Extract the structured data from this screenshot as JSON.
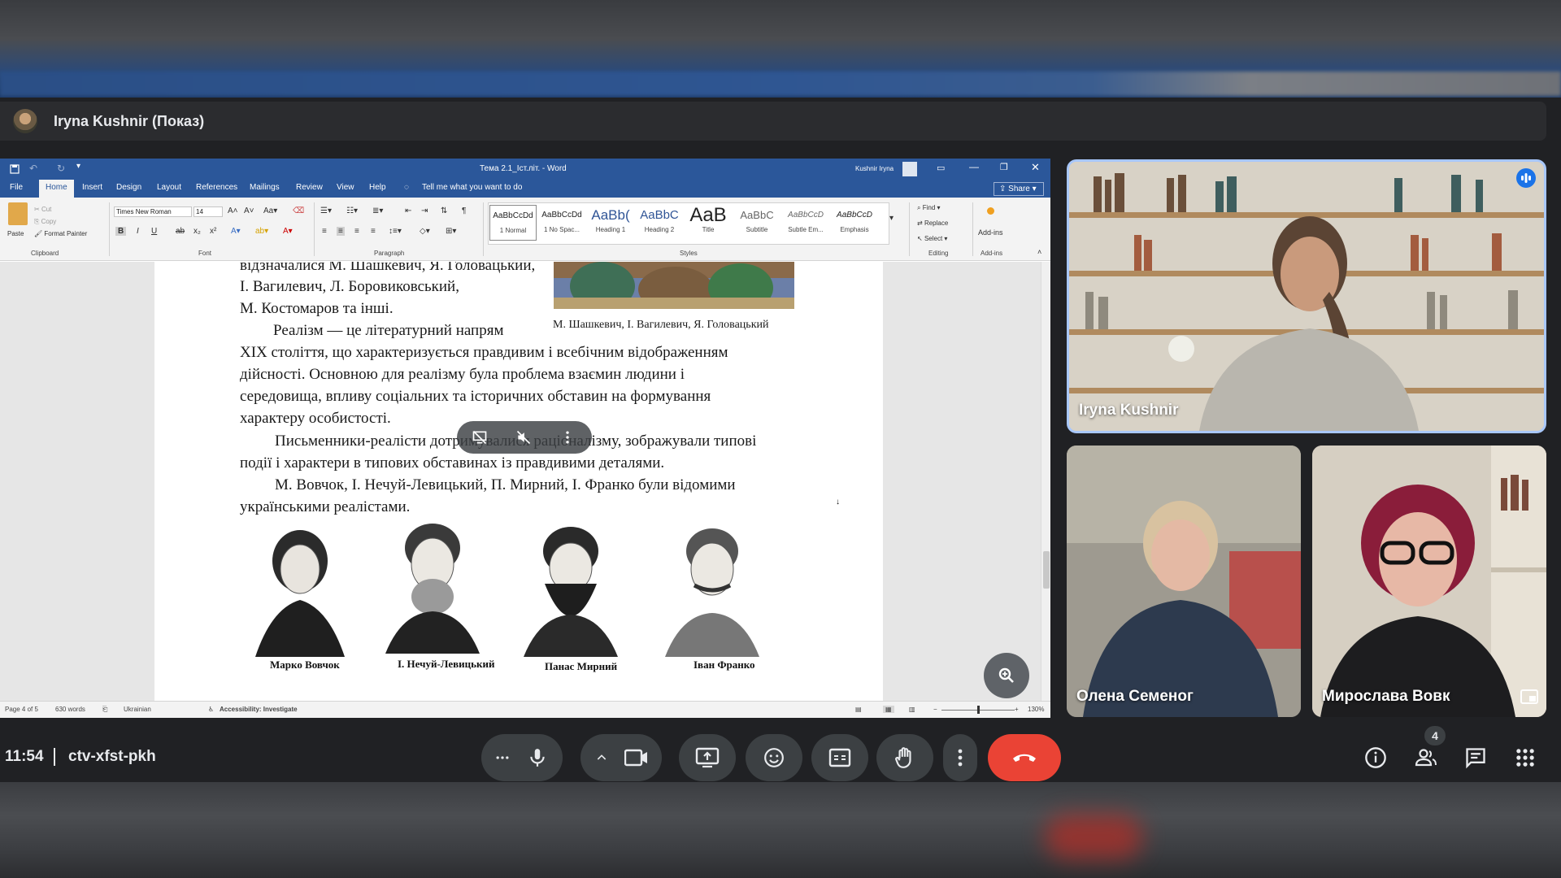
{
  "presenter": {
    "name": "Iryna Kushnir (Показ)"
  },
  "word": {
    "title": "Тема 2.1_Іст.літ.  -  Word",
    "user": "Kushnir Iryna",
    "tabs": [
      "File",
      "Home",
      "Insert",
      "Design",
      "Layout",
      "References",
      "Mailings",
      "Review",
      "View",
      "Help"
    ],
    "tell_me": "Tell me what you want to do",
    "share": "Share",
    "clipboard": {
      "paste": "Paste",
      "cut": "Cut",
      "copy": "Copy",
      "format_painter": "Format Painter",
      "label": "Clipboard"
    },
    "font": {
      "name": "Times New Roman",
      "size": "14",
      "label": "Font"
    },
    "paragraph_label": "Paragraph",
    "styles": [
      {
        "sample": "AaBbCcDd",
        "name": "1 Normal"
      },
      {
        "sample": "AaBbCcDd",
        "name": "1 No Spac..."
      },
      {
        "sample": "AaBb(",
        "name": "Heading 1"
      },
      {
        "sample": "AaBbC",
        "name": "Heading 2"
      },
      {
        "sample": "AaB",
        "name": "Title"
      },
      {
        "sample": "AaBbC",
        "name": "Subtitle"
      },
      {
        "sample": "AaBbCcD",
        "name": "Subtle Em..."
      },
      {
        "sample": "AaBbCcD",
        "name": "Emphasis"
      }
    ],
    "styles_label": "Styles",
    "editing": {
      "find": "Find",
      "replace": "Replace",
      "select": "Select",
      "label": "Editing"
    },
    "addins": {
      "button": "Add-ins",
      "label": "Add-ins"
    },
    "doc": {
      "lines_top": [
        "відзначалися М. Шашкевич, Я. Головацький,",
        "І.   Вагилевич,   Л.   Боровиковський,",
        "М. Костомаров та інші."
      ],
      "image_caption": "М. Шашкевич, І. Вагилевич, Я. Головацький",
      "para1": [
        "Реалізм — це літературний напрям",
        "XIX століття, що характеризується правдивим і всебічним відображенням",
        "дійсності. Основною для реалізму була проблема взаємин людини і",
        "середовища, впливу соціальних та історичних обставин на формування",
        "характеру особистості."
      ],
      "para2": [
        "Письменники-реалісти дотримувалися раціоналізму, зображували типові",
        "події і характери в типових обставинах із правдивими деталями."
      ],
      "para3": [
        "М. Вовчок, І. Нечуй-Левицький, П. Мирний, І. Франко були відомими",
        "українськими реалістами."
      ],
      "portraits": [
        "Марко Вовчок",
        "І. Нечуй-Левицький",
        "Панас Мирний",
        "Іван Франко"
      ]
    },
    "status": {
      "page": "Page 4 of 5",
      "words": "630 words",
      "language": "Ukrainian",
      "accessibility": "Accessibility: Investigate",
      "zoom": "130%"
    }
  },
  "participants": [
    {
      "name": "Iryna Kushnir"
    },
    {
      "name": "Олена Семеног"
    },
    {
      "name": "Мирослава Вовк"
    }
  ],
  "meeting": {
    "time": "11:54",
    "code": "ctv-xfst-pkh",
    "people_count": "4"
  },
  "colors": {
    "word_blue": "#2b579a",
    "meet_bg": "#202124",
    "leave_red": "#ea4335",
    "active_speaker": "#a8c7fa"
  }
}
